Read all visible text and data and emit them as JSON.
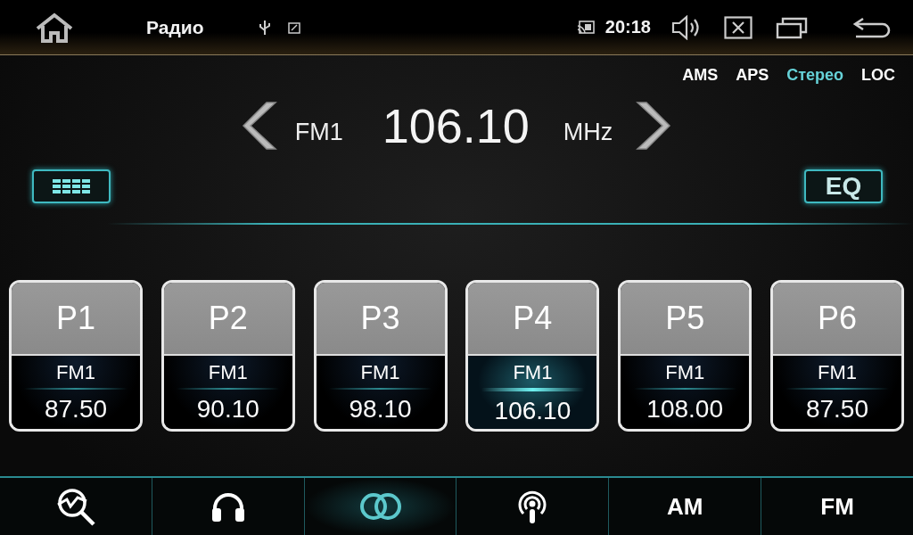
{
  "status_bar": {
    "title": "Радио",
    "time": "20:18"
  },
  "options": [
    {
      "label": "AMS",
      "selected": false
    },
    {
      "label": "APS",
      "selected": false
    },
    {
      "label": "Стерео",
      "selected": true
    },
    {
      "label": "LOC",
      "selected": false
    }
  ],
  "tuner": {
    "band": "FM1",
    "frequency": "106.10",
    "unit": "MHz"
  },
  "eq_button": "EQ",
  "presets": [
    {
      "label": "P1",
      "band": "FM1",
      "frequency": "87.50",
      "selected": false
    },
    {
      "label": "P2",
      "band": "FM1",
      "frequency": "90.10",
      "selected": false
    },
    {
      "label": "P3",
      "band": "FM1",
      "frequency": "98.10",
      "selected": false
    },
    {
      "label": "P4",
      "band": "FM1",
      "frequency": "106.10",
      "selected": true
    },
    {
      "label": "P5",
      "band": "FM1",
      "frequency": "108.00",
      "selected": false
    },
    {
      "label": "P6",
      "band": "FM1",
      "frequency": "87.50",
      "selected": false
    }
  ],
  "bottom_nav": [
    {
      "kind": "icon",
      "selected": false
    },
    {
      "kind": "icon",
      "selected": false
    },
    {
      "kind": "icon",
      "selected": true
    },
    {
      "kind": "icon",
      "selected": false
    },
    {
      "kind": "text",
      "label": "AM",
      "selected": false
    },
    {
      "kind": "text",
      "label": "FM",
      "selected": false
    }
  ]
}
